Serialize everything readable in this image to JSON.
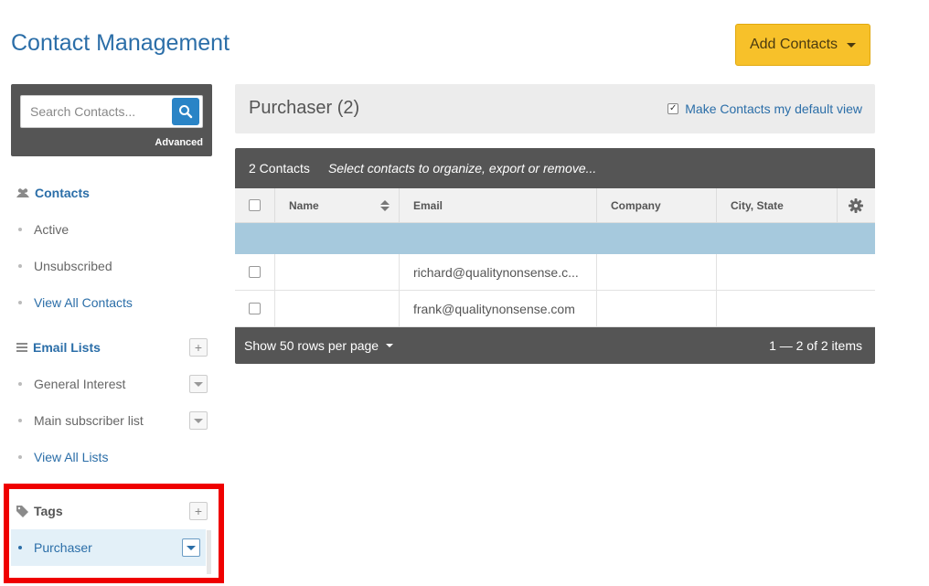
{
  "header": {
    "title": "Contact Management",
    "add_button_label": "Add Contacts"
  },
  "sidebar": {
    "search": {
      "placeholder": "Search Contacts...",
      "advanced_label": "Advanced"
    },
    "contacts": {
      "heading": "Contacts",
      "items": [
        {
          "label": "Active"
        },
        {
          "label": "Unsubscribed"
        },
        {
          "label": "View All Contacts"
        }
      ]
    },
    "email_lists": {
      "heading": "Email Lists",
      "items": [
        {
          "label": "General Interest"
        },
        {
          "label": "Main subscriber list"
        },
        {
          "label": "View All Lists"
        }
      ]
    },
    "tags": {
      "heading": "Tags",
      "items": [
        {
          "label": "Purchaser"
        }
      ]
    }
  },
  "main": {
    "view_title": "Purchaser (2)",
    "default_view_label": "Make Contacts my default view",
    "default_view_checked": true,
    "toolbar": {
      "count": "2 Contacts",
      "hint": "Select contacts to organize, export or remove..."
    },
    "columns": [
      "Name",
      "Email",
      "Company",
      "City, State"
    ],
    "rows": [
      {
        "name": "",
        "email": "richard@qualitynonsense.c...",
        "company": "",
        "city_state": ""
      },
      {
        "name": "",
        "email": "frank@qualitynonsense.com",
        "company": "",
        "city_state": ""
      }
    ],
    "footer": {
      "rows_per_page": "Show 50 rows per page",
      "pager": "1 — 2 of 2 items"
    }
  },
  "colors": {
    "accent": "#2b6ea8",
    "add_button": "#f7c12a",
    "dark_bar": "#555555",
    "selected_row": "#a6c9dd",
    "highlight_box": "#ef0000"
  }
}
